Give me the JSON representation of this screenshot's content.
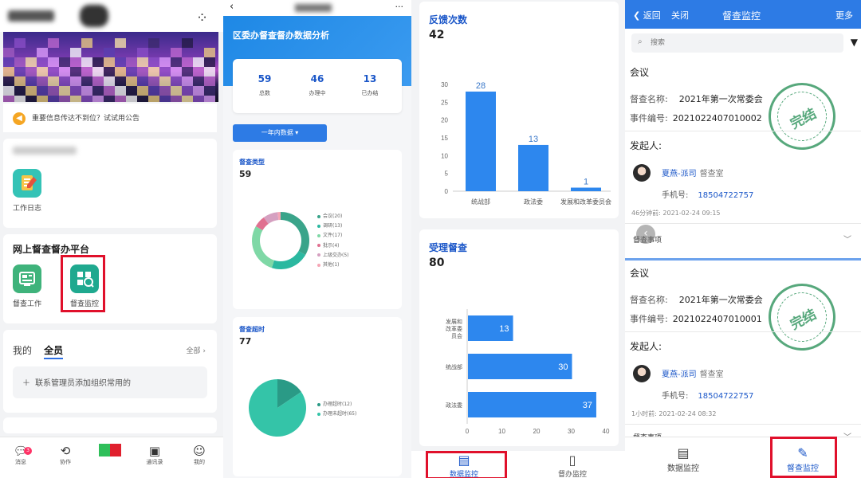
{
  "colors": {
    "accent": "#2d7be5",
    "brand_blue": "#1a56c8",
    "highlight": "#e0102b",
    "stamp_green": "#3a9a66"
  },
  "panel1": {
    "notice": "重要信息传达不到位？试试用公告",
    "app_work_log": "工作日志",
    "platform_title": "网上督查督办平台",
    "app_supervise_work": "督查工作",
    "app_supervise_monitor": "督查监控",
    "tab_mine": "我的",
    "tab_all_staff": "全员",
    "all_link": "全部",
    "add_org_hint": "联系管理员添加组织常用的",
    "tabbar": [
      {
        "label": "消息",
        "icon": "message-icon",
        "badge": "3"
      },
      {
        "label": "协作",
        "icon": "collab-icon"
      },
      {
        "label": "",
        "icon": "workbench-icon"
      },
      {
        "label": "通讯录",
        "icon": "contacts-icon"
      },
      {
        "label": "我的",
        "icon": "profile-icon"
      }
    ]
  },
  "panel2": {
    "title": "区委办督查督办数据分析",
    "stats": [
      {
        "value": "59",
        "label": "总数"
      },
      {
        "value": "46",
        "label": "办理中"
      },
      {
        "value": "13",
        "label": "已办结"
      }
    ],
    "period_select": "一年内数据",
    "type_title": "督查类型",
    "type_total": "59",
    "type_legend": [
      "会议(20)",
      "调研(13)",
      "文件(17)",
      "批示(4)",
      "上级交办(5)",
      "其他(1)"
    ],
    "overtime_title": "督查超时",
    "overtime_total": "77",
    "overtime_legend": [
      "办理超时(12)",
      "办理未超时(65)"
    ]
  },
  "panel3": {
    "feedback_title": "反馈次数",
    "feedback_total": "42",
    "accept_title": "受理督查",
    "accept_total": "80",
    "bottombar": [
      {
        "label": "数据监控",
        "icon": "data-monitor-icon"
      },
      {
        "label": "督办监控",
        "icon": "supervise-monitor-icon"
      }
    ]
  },
  "panel4": {
    "nav": {
      "back": "返回",
      "close": "关闭",
      "title": "督查监控",
      "more": "更多"
    },
    "search_placeholder": "搜索",
    "records": [
      {
        "type": "会议",
        "name_label": "督查名称:",
        "name": "2021年第一次常委会",
        "code_label": "事件编号:",
        "code": "2021022407010002",
        "stamp": "完结",
        "initiator_label": "发起人:",
        "person": "夏燕-派司",
        "dept": "督查室",
        "phone_label": "手机号:",
        "phone": "18504722757",
        "time": "46分钟前: 2021-02-24 09:15",
        "matter": "督查事项"
      },
      {
        "type": "会议",
        "name_label": "督查名称:",
        "name": "2021年第一次常委会",
        "code_label": "事件编号:",
        "code": "2021022407010001",
        "stamp": "完结",
        "initiator_label": "发起人:",
        "person": "夏燕-派司",
        "dept": "督查室",
        "phone_label": "手机号:",
        "phone": "18504722757",
        "time": "1小时前: 2021-02-24 08:32",
        "matter": "督查事项"
      }
    ],
    "bottombar": [
      {
        "label": "数据监控",
        "icon": "data-monitor-icon"
      },
      {
        "label": "督查监控",
        "icon": "supervise-monitor-icon"
      }
    ]
  },
  "chart_data": [
    {
      "type": "pie",
      "title": "督查类型",
      "categories": [
        "会议",
        "调研",
        "文件",
        "批示",
        "上级交办",
        "其他"
      ],
      "values": [
        20,
        13,
        17,
        4,
        5,
        1
      ],
      "colors": [
        "#3aa48a",
        "#2bb8a0",
        "#7fd8a6",
        "#e07090",
        "#d5a0c0",
        "#f5a5b5"
      ],
      "legend_position": "right"
    },
    {
      "type": "pie",
      "title": "督查超时",
      "categories": [
        "办理超时",
        "办理未超时"
      ],
      "values": [
        12,
        65
      ],
      "colors": [
        "#2a9a86",
        "#34c4a8"
      ],
      "legend_position": "right"
    },
    {
      "type": "bar",
      "title": "反馈次数",
      "categories": [
        "统战部",
        "政法委",
        "发展和改革委员会"
      ],
      "values": [
        28,
        13,
        1
      ],
      "ylim": [
        0,
        30
      ],
      "yticks": [
        "0",
        "5",
        "10",
        "15",
        "20",
        "25",
        "30"
      ],
      "color": "#2d87ee",
      "grid": false
    },
    {
      "type": "bar",
      "orientation": "horizontal",
      "title": "受理督查",
      "categories": [
        "发展和改革委员会",
        "统战部",
        "政法委"
      ],
      "category_tick_labels": [
        "发展和\n改革委\n员会",
        "统战部",
        "政法委"
      ],
      "values": [
        13,
        30,
        37
      ],
      "xlim": [
        0,
        40
      ],
      "xticks": [
        "0",
        "10",
        "20",
        "30",
        "40"
      ],
      "color": "#2d87ee",
      "grid": false
    }
  ]
}
